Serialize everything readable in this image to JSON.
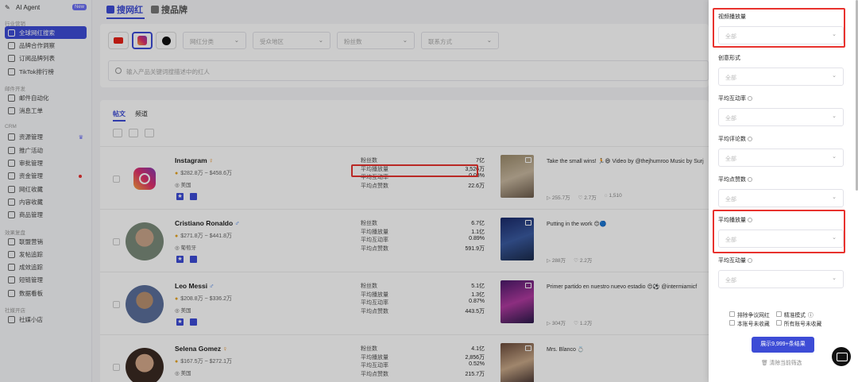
{
  "sidebar": {
    "brand": "AI Agent",
    "brand_badge": "New",
    "sections": [
      {
        "title": "行业营销",
        "items": [
          {
            "label": "全球网红搜索",
            "active": true
          },
          {
            "label": "品牌合作洞察"
          },
          {
            "label": "订阅品牌列表"
          },
          {
            "label": "TikTok排行榜"
          }
        ]
      },
      {
        "title": "邮件开发",
        "items": [
          {
            "label": "邮件自动化"
          },
          {
            "label": "消息工单"
          }
        ]
      },
      {
        "title": "CRM",
        "items": [
          {
            "label": "资源管理"
          },
          {
            "label": "推广活动"
          },
          {
            "label": "审批管理"
          },
          {
            "label": "资金管理"
          },
          {
            "label": "网红收藏"
          },
          {
            "label": "内容收藏"
          },
          {
            "label": "商品管理"
          }
        ]
      },
      {
        "title": "效果复盘",
        "items": [
          {
            "label": "联盟营销"
          },
          {
            "label": "发帖追踪"
          },
          {
            "label": "成效追踪"
          },
          {
            "label": "短链管理"
          },
          {
            "label": "数据看板"
          }
        ]
      },
      {
        "title": "社媒开店",
        "items": [
          {
            "label": "社媒小店"
          }
        ]
      }
    ]
  },
  "top_tabs": [
    {
      "label": "搜网红",
      "active": true
    },
    {
      "label": "搜品牌"
    }
  ],
  "filters": {
    "selects": [
      "网红分类",
      "受众地区",
      "粉丝数",
      "联系方式"
    ],
    "search_placeholder": "输入产品关键词搜描述中的红人"
  },
  "list_tabs": [
    "帖文",
    "频道"
  ],
  "stat_labels": [
    "粉丝数",
    "平均播放量",
    "平均互动率",
    "平均点赞数"
  ],
  "influencers": [
    {
      "name": "Instagram",
      "gender": "♀",
      "price": "$282.8万 ~ $458.6万",
      "location": "美国",
      "stats": [
        "7亿",
        "3,526万",
        "0.03%",
        "22.6万"
      ],
      "post_text": "Take the small wins! 🏃😄 Video by @thejhumroo Music by Surj",
      "post_meta": [
        "255.7万",
        "2.7万",
        "1,510"
      ]
    },
    {
      "name": "Cristiano Ronaldo",
      "gender": "♂",
      "price": "$271.8万 ~ $441.8万",
      "location": "葡萄牙",
      "stats": [
        "6.7亿",
        "1.1亿",
        "0.89%",
        "591.9万"
      ],
      "post_text": "Putting in the work 😊🔵",
      "post_meta": [
        "288万",
        "2.2万"
      ]
    },
    {
      "name": "Leo Messi",
      "gender": "♂",
      "price": "$208.8万 ~ $336.2万",
      "location": "美国",
      "stats": [
        "5.1亿",
        "1.3亿",
        "0.87%",
        "443.5万"
      ],
      "post_text": "Primer partido en nuestro nuevo estadio 😍⚽ @intermiamicf",
      "post_meta": [
        "304万",
        "1.2万"
      ]
    },
    {
      "name": "Selena Gomez",
      "gender": "♀",
      "price": "$167.5万 ~ $272.1万",
      "location": "美国",
      "stats": [
        "4.1亿",
        "2,856万",
        "0.52%",
        "215.7万"
      ],
      "post_text": "Mrs. Blanco 💍",
      "post_meta": []
    }
  ],
  "panel": {
    "fields": [
      {
        "label": "视频播放量",
        "value": "全部",
        "help": false
      },
      {
        "label": "创意形式",
        "value": "全部",
        "help": false
      },
      {
        "label": "平均互动率",
        "value": "全部",
        "help": true
      },
      {
        "label": "平均评论数",
        "value": "全部",
        "help": true
      },
      {
        "label": "平均点赞数",
        "value": "全部",
        "help": true
      },
      {
        "label": "平均播放量",
        "value": "全部",
        "help": true
      },
      {
        "label": "平均互动量",
        "value": "全部",
        "help": true
      }
    ],
    "checks": [
      "排除争议网红",
      "精准模式",
      "本账号未收藏",
      "所有账号未收藏"
    ],
    "show_button": "展示9,999+条结果",
    "clear": "清除当前筛选"
  },
  "colors": {
    "accent": "#3d4cd6",
    "highlight": "#e8322e"
  }
}
